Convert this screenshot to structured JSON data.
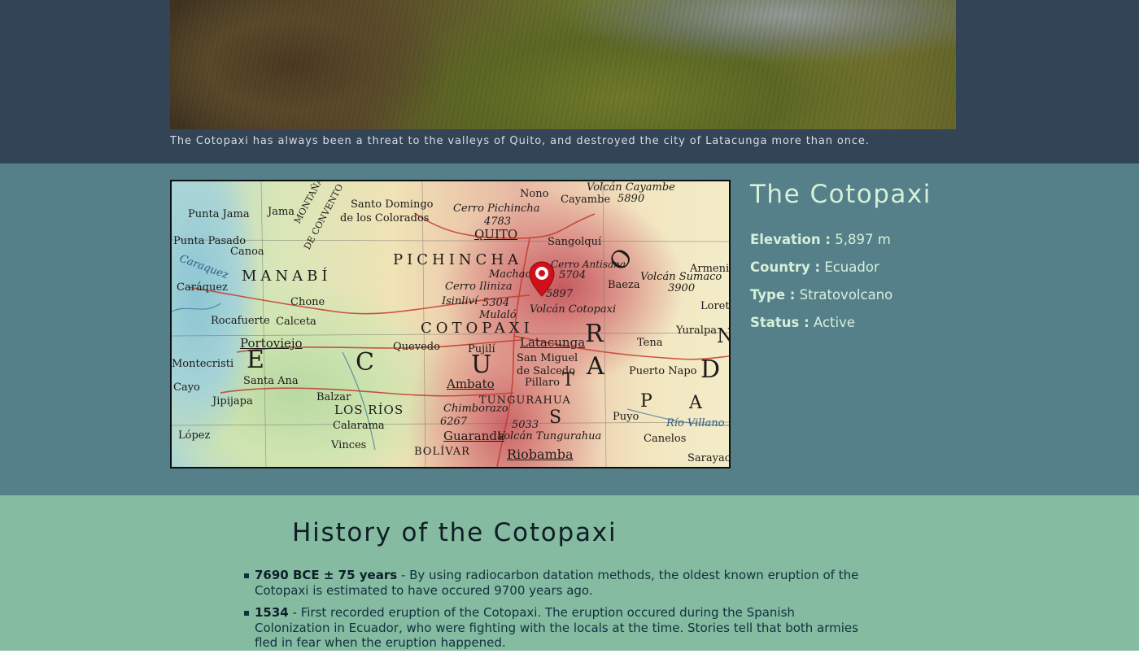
{
  "hero": {
    "caption": "The Cotopaxi has always been a threat to the valleys of Quito, and destroyed the city of Latacunga more than once."
  },
  "map": {
    "labels": [
      "Volcán Cayambe",
      "Cayambe",
      "5890",
      "Nono",
      "Santo Domingo",
      "de los Colorados",
      "Cerro Pichincha",
      "4783",
      "QUITO",
      "Sangolquí",
      "Punta Jama",
      "Jama",
      "MONTAÑA",
      "DE CONVENTO",
      "Punta Pasado",
      "Canoa",
      "Caraquez",
      "PICHINCHA",
      "Machachi",
      "Cerro Antisana",
      "5704",
      "Armenia",
      "MANABÍ",
      "Cerro Iliniza",
      "5897",
      "Baeza",
      "Volcán Sumaco",
      "3900",
      "Caráquez",
      "Chone",
      "Isinliví",
      "5304",
      "Mulaló",
      "Volcán Cotopaxi",
      "Loreto",
      "Rocafuerte",
      "Calceta",
      "COTOPAXI",
      "Yuralpa",
      "Portoviejo",
      "Quevedo",
      "Pujilí",
      "Latacunga",
      "Tena",
      "Montecristi",
      "San Miguel",
      "de Salcedo",
      "Pillaro",
      "Puerto Napo",
      "Santa Ana",
      "Ambato",
      "Cayo",
      "Jipijapa",
      "Balzar",
      "TUNGURAHUA",
      "LOS RÍOS",
      "Chimborazo",
      "6267",
      "Puyo",
      "Río Villano",
      "5033",
      "Calarama",
      "López",
      "Guaranda",
      "Volcán Tungurahua",
      "Canelos",
      "Vinces",
      "BOLÍVAR",
      "Riobamba",
      "Sarayac",
      "E",
      "C",
      "U",
      "A",
      "D",
      "O",
      "R",
      "P",
      "A",
      "S",
      "T",
      "A",
      "Z",
      "A",
      "N"
    ]
  },
  "volcano": {
    "title": "The Cotopaxi",
    "facts": [
      {
        "key": "Elevation :",
        "value": "5,897 m"
      },
      {
        "key": "Country :",
        "value": "Ecuador"
      },
      {
        "key": "Type :",
        "value": "Stratovolcano"
      },
      {
        "key": "Status :",
        "value": "Active"
      }
    ]
  },
  "history": {
    "title": "History of the Cotopaxi",
    "events": [
      {
        "date": "7690 BCE ± 75 years",
        "text": " - By using radiocarbon datation methods, the oldest known eruption of the Cotopaxi is estimated to have occured 9700 years ago."
      },
      {
        "date": "1534",
        "text": " - First recorded eruption of the Cotopaxi. The eruption occured during the Spanish Colonization in Ecuador, who were fighting with the locals at the time. Stories tell that both armies fled in fear when the eruption happened."
      }
    ]
  },
  "colors": {
    "hero_bg": "#334457",
    "info_bg": "#558089",
    "history_bg": "#85bba0",
    "marker_red": "#d0101a"
  }
}
